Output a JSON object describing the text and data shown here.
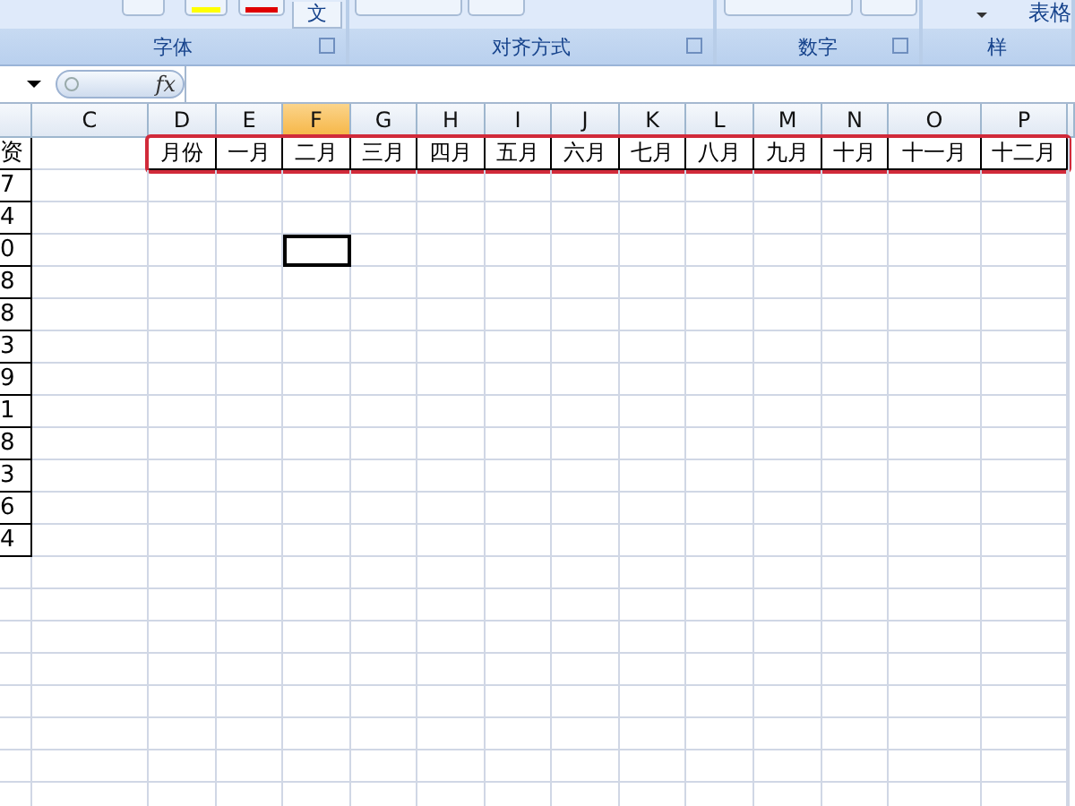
{
  "ribbon": {
    "groups": [
      {
        "label": "字体",
        "launcher": true
      },
      {
        "label": "对齐方式",
        "launcher": true
      },
      {
        "label": "数字",
        "launcher": true
      },
      {
        "label": "样",
        "launcher": false
      }
    ],
    "phonetic_button": "文",
    "styles_button": "表格"
  },
  "formula_bar": {
    "function_button": "fx"
  },
  "sheet": {
    "columns": [
      {
        "label": "C",
        "selected": false
      },
      {
        "label": "D",
        "selected": false
      },
      {
        "label": "E",
        "selected": false
      },
      {
        "label": "F",
        "selected": true
      },
      {
        "label": "G",
        "selected": false
      },
      {
        "label": "H",
        "selected": false
      },
      {
        "label": "I",
        "selected": false
      },
      {
        "label": "J",
        "selected": false
      },
      {
        "label": "K",
        "selected": false
      },
      {
        "label": "L",
        "selected": false
      },
      {
        "label": "M",
        "selected": false
      },
      {
        "label": "N",
        "selected": false
      },
      {
        "label": "O",
        "selected": false
      },
      {
        "label": "P",
        "selected": false
      }
    ],
    "month_headers": [
      "月份",
      "一月",
      "二月",
      "三月",
      "四月",
      "五月",
      "六月",
      "七月",
      "八月",
      "九月",
      "十月",
      "十一月",
      "十二月"
    ],
    "month_headers_outlined": true,
    "rows": [
      {
        "cut_cell": "资"
      },
      {
        "cut_cell": "7",
        "active": false
      },
      {
        "cut_cell": "4",
        "active": false
      },
      {
        "cut_cell": "0",
        "active": true
      },
      {
        "cut_cell": "8",
        "active": false
      },
      {
        "cut_cell": "8",
        "active": false
      },
      {
        "cut_cell": "3",
        "active": false
      },
      {
        "cut_cell": "9",
        "active": false
      },
      {
        "cut_cell": "1",
        "active": false
      },
      {
        "cut_cell": "8",
        "active": false
      },
      {
        "cut_cell": "3",
        "active": false
      },
      {
        "cut_cell": "6",
        "active": false
      },
      {
        "cut_cell": "4",
        "active": false
      },
      {
        "active": false
      },
      {
        "active": false
      },
      {
        "active": false
      },
      {
        "active": false
      },
      {
        "active": false
      },
      {
        "active": false
      },
      {
        "active": false
      },
      {
        "active": false
      }
    ]
  }
}
